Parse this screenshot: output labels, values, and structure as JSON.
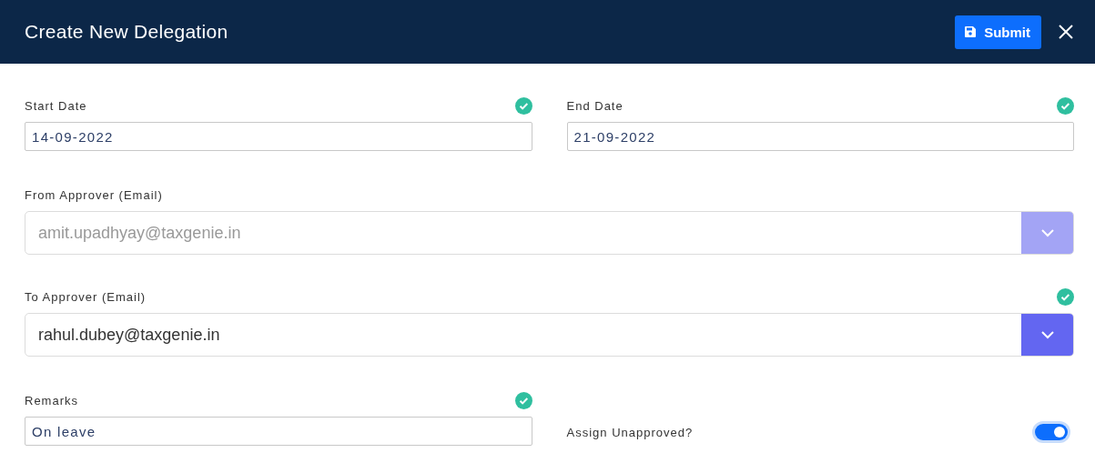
{
  "header": {
    "title": "Create New Delegation",
    "submit_label": "Submit"
  },
  "dates": [
    {
      "label": "Start Date",
      "value": "14-09-2022",
      "valid": true
    },
    {
      "label": "End Date",
      "value": "21-09-2022",
      "valid": true
    }
  ],
  "approvers": [
    {
      "label": "From Approver (Email)",
      "value": "amit.upadhyay@taxgenie.in",
      "valid": false,
      "disabled": true
    },
    {
      "label": "To Approver (Email)",
      "value": "rahul.dubey@taxgenie.in",
      "valid": true,
      "disabled": false
    }
  ],
  "remarks": {
    "label": "Remarks",
    "value": "On leave",
    "valid": true
  },
  "assign_unapproved": {
    "label": "Assign Unapproved?",
    "on": true
  }
}
